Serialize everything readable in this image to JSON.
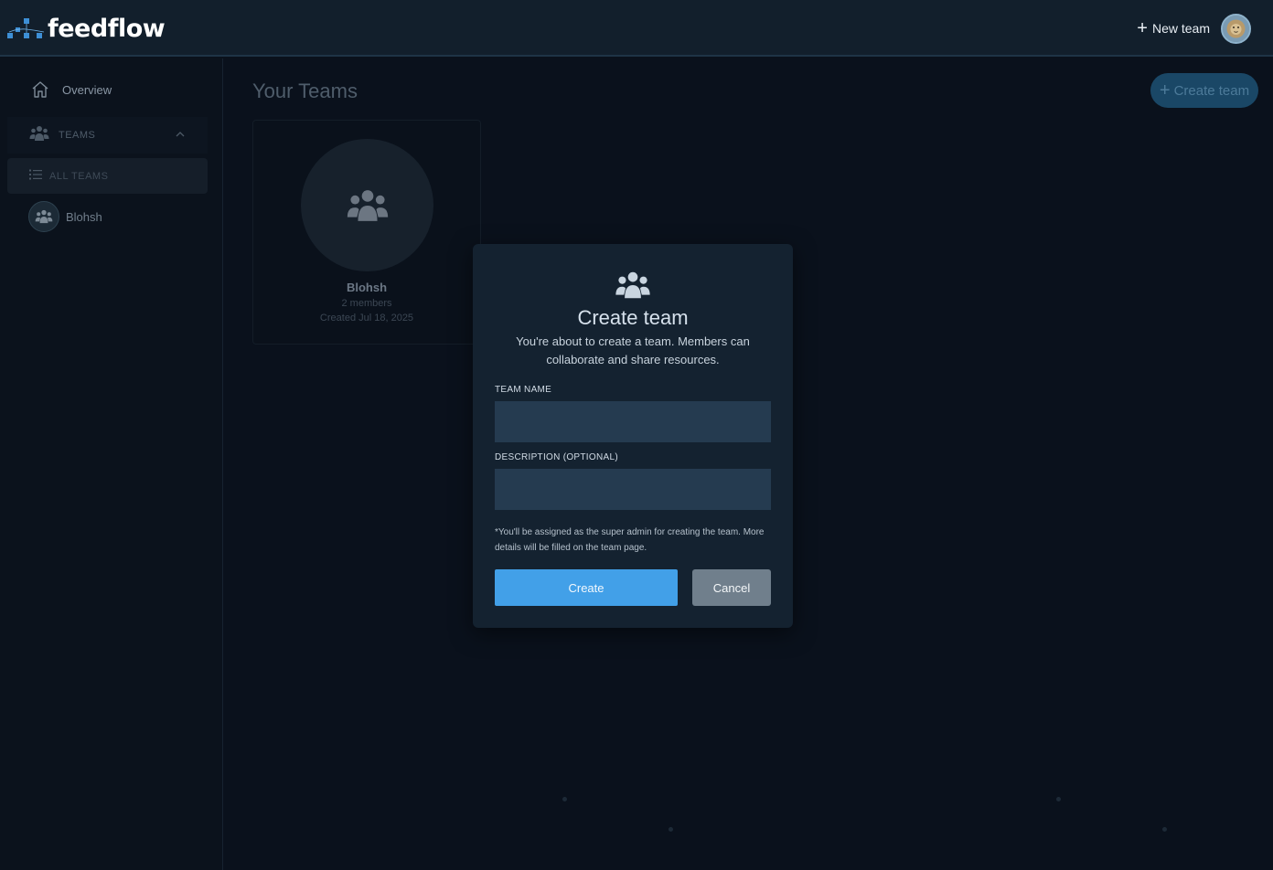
{
  "app": {
    "name": "feedflow",
    "logo_icon": "feedflow-logo-icon"
  },
  "header": {
    "new_team_label": "New team",
    "user_avatar": "lion-avatar-icon"
  },
  "sidebar": {
    "overview_label": "Overview",
    "teams_section_label": "TEAMS",
    "all_teams_label": "ALL TEAMS",
    "teams": [
      {
        "name": "Blohsh"
      }
    ]
  },
  "main": {
    "title": "Your Teams",
    "create_team_label": "Create team",
    "cards": [
      {
        "name": "Blohsh",
        "members": "2 members",
        "created": "Created Jul 18, 2025"
      }
    ]
  },
  "modal": {
    "icon": "team-group-icon",
    "title": "Create team",
    "description": "You're about to create a team. Members can collaborate and share resources.",
    "team_name_label": "TEAM NAME",
    "team_name_value": "",
    "team_name_placeholder": "",
    "description_label": "DESCRIPTION (OPTIONAL)",
    "description_value": "",
    "description_placeholder": "",
    "note": "*You'll be assigned as the super admin for creating the team. More details will be filled on the team page.",
    "create_label": "Create",
    "cancel_label": "Cancel"
  },
  "colors": {
    "accent": "#42a0e8",
    "header_bg": "#121f2c",
    "modal_bg": "#142230",
    "input_bg": "#253b50",
    "cancel_bg": "#707f8c"
  }
}
